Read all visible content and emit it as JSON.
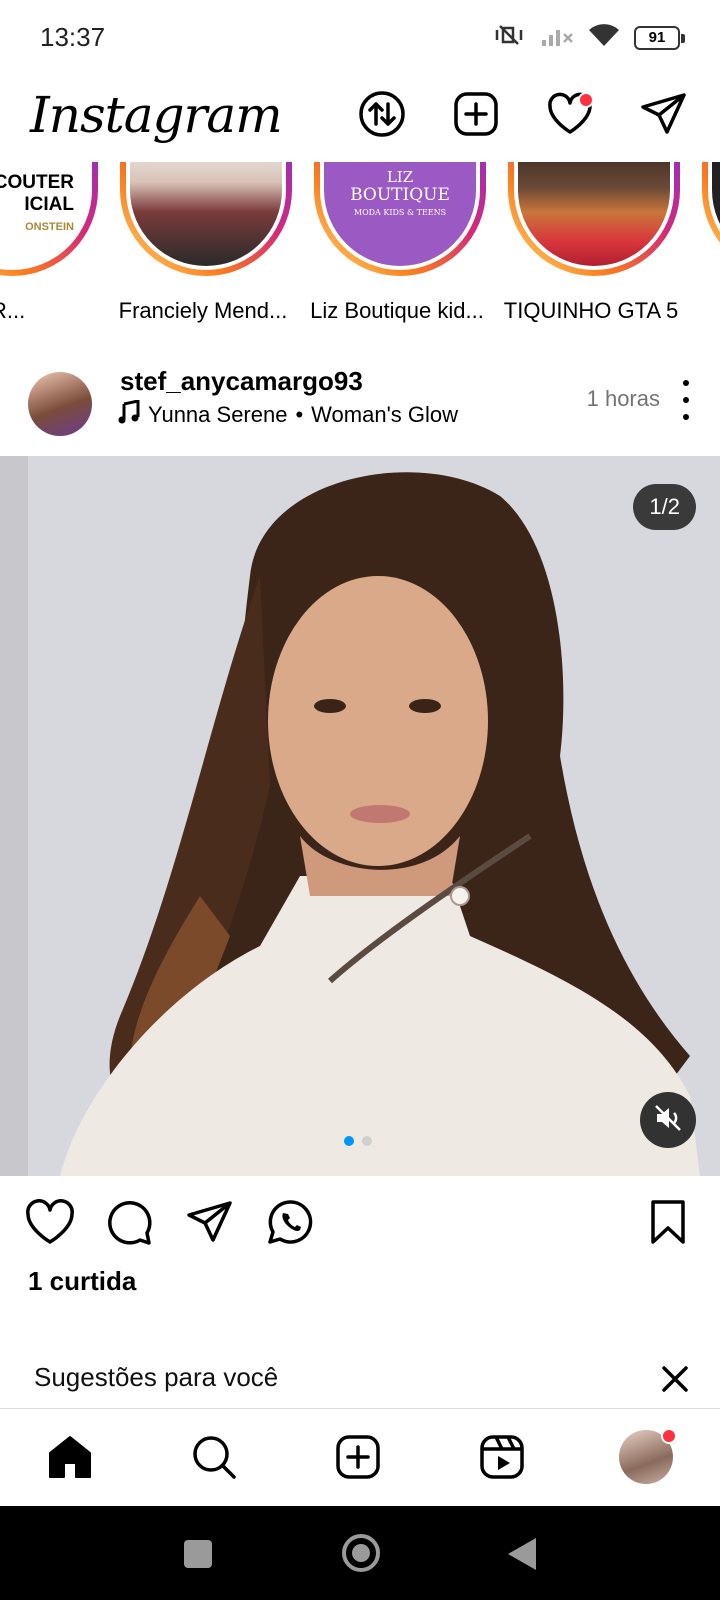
{
  "status": {
    "time": "13:37",
    "battery": "91"
  },
  "header": {
    "logo": "Instagram"
  },
  "stories": [
    {
      "name": "COUTER...",
      "logo_lines": [
        "SCOUTER",
        "ICIAL",
        "ONSTEIN"
      ]
    },
    {
      "name": "Franciely Mend..."
    },
    {
      "name": "Liz Boutique kid...",
      "logo_lines": [
        "LIZ",
        "BOUTIQUE",
        "MODA KIDS & TEENS"
      ]
    },
    {
      "name": "TIQUINHO GTA 5"
    }
  ],
  "post": {
    "username": "stef_anycamargo93",
    "music_artist": "Yunna Serene",
    "music_track": "Woman's Glow",
    "time_ago": "1 horas",
    "counter": "1/2",
    "current_slide": 1,
    "total_slides": 2,
    "likes": "1 curtida"
  },
  "suggestions": {
    "title": "Sugestões para você"
  },
  "colors": {
    "accent": "#0095f6",
    "notification": "#ff3040"
  }
}
